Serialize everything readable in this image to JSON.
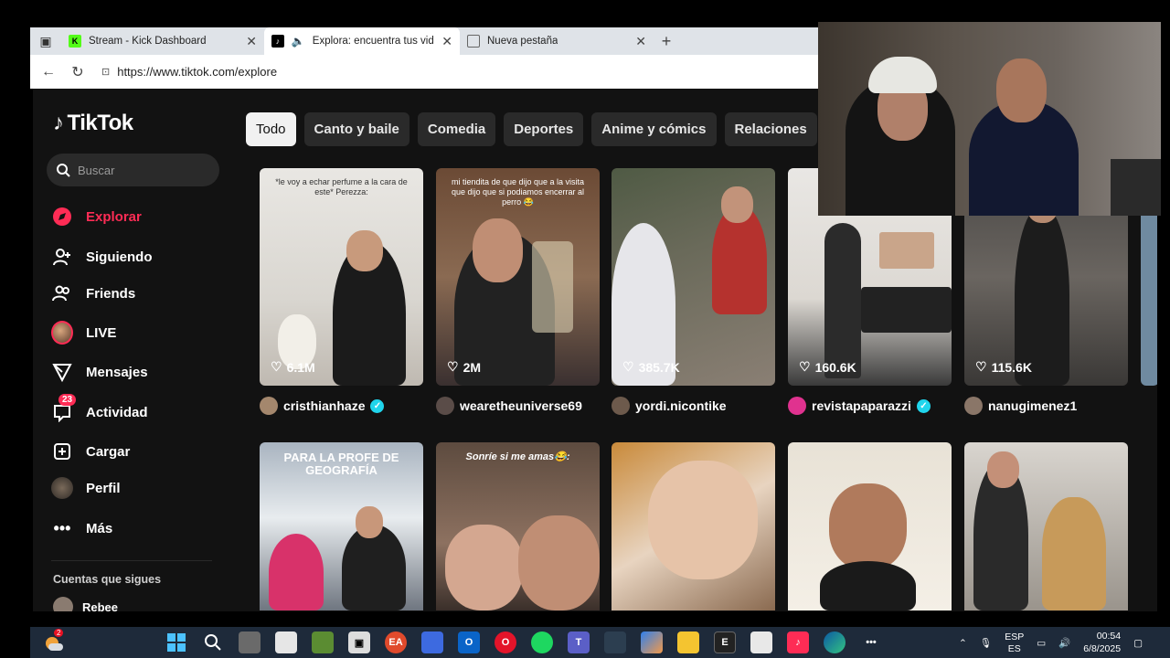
{
  "browser": {
    "tabs": [
      {
        "title": "Stream - Kick Dashboard",
        "favicon": "kick-icon",
        "active": false
      },
      {
        "title": "Explora: encuentra tus videos",
        "favicon": "tiktok-icon",
        "active": true
      },
      {
        "title": "Nueva pestaña",
        "favicon": "newtab-icon",
        "active": false
      }
    ],
    "url": "https://www.tiktok.com/explore"
  },
  "tiktok": {
    "logo": "TikTok",
    "search_placeholder": "Buscar",
    "nav": [
      {
        "label": "Explorar",
        "icon": "compass-icon",
        "active": true
      },
      {
        "label": "Siguiendo",
        "icon": "user-follow-icon"
      },
      {
        "label": "Friends",
        "icon": "friends-icon"
      },
      {
        "label": "LIVE",
        "icon": "live-avatar-icon"
      },
      {
        "label": "Mensajes",
        "icon": "send-icon"
      },
      {
        "label": "Actividad",
        "icon": "inbox-icon",
        "badge": "23"
      },
      {
        "label": "Cargar",
        "icon": "upload-icon"
      },
      {
        "label": "Perfil",
        "icon": "profile-avatar-icon"
      },
      {
        "label": "Más",
        "icon": "more-icon"
      }
    ],
    "following_title": "Cuentas que sigues",
    "following": [
      {
        "name": "Rebee"
      }
    ],
    "chips": [
      {
        "label": "Todo",
        "active": true
      },
      {
        "label": "Canto y baile"
      },
      {
        "label": "Comedia"
      },
      {
        "label": "Deportes"
      },
      {
        "label": "Anime y cómics"
      },
      {
        "label": "Relaciones"
      }
    ],
    "videos_row1": [
      {
        "likes": "6.1M",
        "author": "cristhianhaze",
        "verified": true,
        "caption": "*le voy a echar perfume a la cara de este*\n\nPerezza:"
      },
      {
        "likes": "2M",
        "author": "wearetheuniverse69",
        "verified": false,
        "caption": "mi tiendita de que dijo que a la visita que dijo que si podiamos encerrar al perro 😂"
      },
      {
        "likes": "385.7K",
        "author": "yordi.nicontike",
        "verified": false,
        "caption": ""
      },
      {
        "likes": "160.6K",
        "author": "revistapaparazzi",
        "verified": true,
        "caption": ""
      },
      {
        "likes": "115.6K",
        "author": "nanugimenez1",
        "verified": false,
        "caption": ""
      }
    ],
    "videos_row2": [
      {
        "caption": "PARA LA PROFE DE GEOGRAFÍA"
      },
      {
        "caption": "Sonríe si me amas😂:"
      },
      {
        "caption": ""
      },
      {
        "caption": ""
      },
      {
        "caption": ""
      }
    ]
  },
  "taskbar": {
    "lang_top": "ESP",
    "lang_bottom": "ES",
    "time": "00:54",
    "date": "6/8/2025",
    "weather_badge": "2"
  }
}
